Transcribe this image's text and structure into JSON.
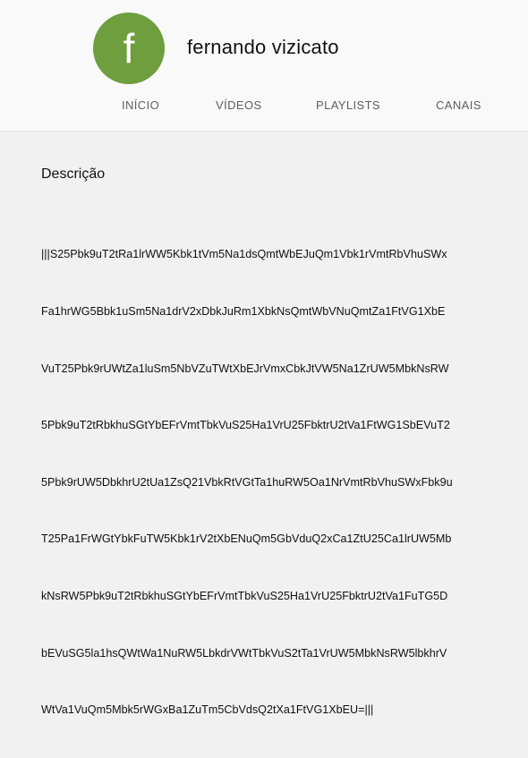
{
  "channel": {
    "avatar_letter": "f",
    "avatar_color": "#6e9e3d",
    "name": "fernando vizicato"
  },
  "tabs": [
    {
      "label": "INÍCIO"
    },
    {
      "label": "VÍDEOS"
    },
    {
      "label": "PLAYLISTS"
    },
    {
      "label": "CANAIS"
    }
  ],
  "about": {
    "section_title": "Descrição",
    "description_lines": [
      "|||S25Pbk9uT2tRa1lrWW5Kbk1tVm5Na1dsQmtWbEJuQm1Vbk1rVmtRbVhuSWx",
      "Fa1hrWG5Bbk1uSm5Na1drV2xDbkJuRm1XbkNsQmtWbVNuQmtZa1FtVG1XbE",
      "VuT25Pbk9rUWtZa1luSm5NbVZuTWtXbEJrVmxCbkJtVW5Na1ZrUW5MbkNsRW",
      "5Pbk9uT2tRbkhuSGtYbEFrVmtTbkVuS25Ha1VrU25FbktrU2tVa1FtWG1SbEVuT2",
      "5Pbk9rUW5DbkhrU2tUa1ZsQ21VbkRtVGtTa1huRW5Oa1NrVmtRbVhuSWxFbk9u",
      "T25Pa1FrWGtYbkFuTW5Kbk1rV2tXbENuQm5GbVduQ2xCa1ZtU25Ca1lrUW5Mb",
      "kNsRW5Pbk9uT2tRbkhuSGtYbEFrVmtTbkVuS25Ha1VrU25FbktrU2tVa1FuTG5D",
      "bEVuSG5la1hsQWtWa1NuRW5LbkdrVWtTbkVuS2tTa1VrUW5MbkNsRW5lbkhrV",
      "WtVa1VuQm5Mbk5rWGxBa1ZuTm5CbVdsQ2tXa1FtVG1XbEU=|||"
    ]
  }
}
